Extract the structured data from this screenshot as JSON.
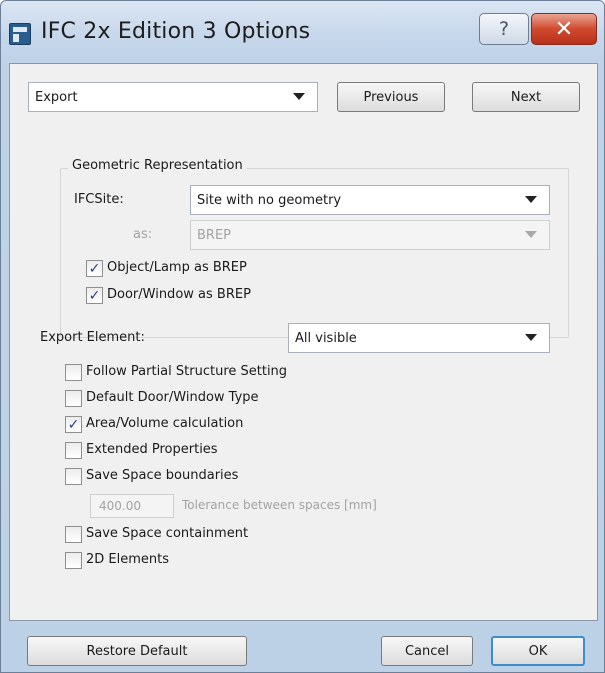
{
  "window": {
    "title": "IFC 2x Edition 3 Options",
    "help_glyph": "?",
    "close_glyph": "✕"
  },
  "top": {
    "mode": "Export",
    "previous_label": "Previous",
    "next_label": "Next"
  },
  "geometric": {
    "group_title": "Geometric Representation",
    "ifcsite_label": "IFCSite:",
    "ifcsite_value": "Site with no geometry",
    "as_label": "as:",
    "as_value": "BREP",
    "object_lamp_label": "Object/Lamp as BREP",
    "object_lamp_checked": true,
    "door_window_label": "Door/Window as BREP",
    "door_window_checked": true
  },
  "export_element": {
    "label": "Export Element:",
    "value": "All visible"
  },
  "options": [
    {
      "label": "Follow Partial Structure Setting",
      "checked": false
    },
    {
      "label": "Default Door/Window Type",
      "checked": false
    },
    {
      "label": "Area/Volume calculation",
      "checked": true
    },
    {
      "label": "Extended Properties",
      "checked": false
    },
    {
      "label": "Save Space boundaries",
      "checked": false
    }
  ],
  "tolerance": {
    "value": "400.00",
    "label": "Tolerance between spaces [mm]"
  },
  "options2": [
    {
      "label": "Save Space containment",
      "checked": false
    },
    {
      "label": "2D Elements",
      "checked": false
    }
  ],
  "footer": {
    "restore_label": "Restore Default",
    "cancel_label": "Cancel",
    "ok_label": "OK"
  },
  "check_glyph": "✓"
}
